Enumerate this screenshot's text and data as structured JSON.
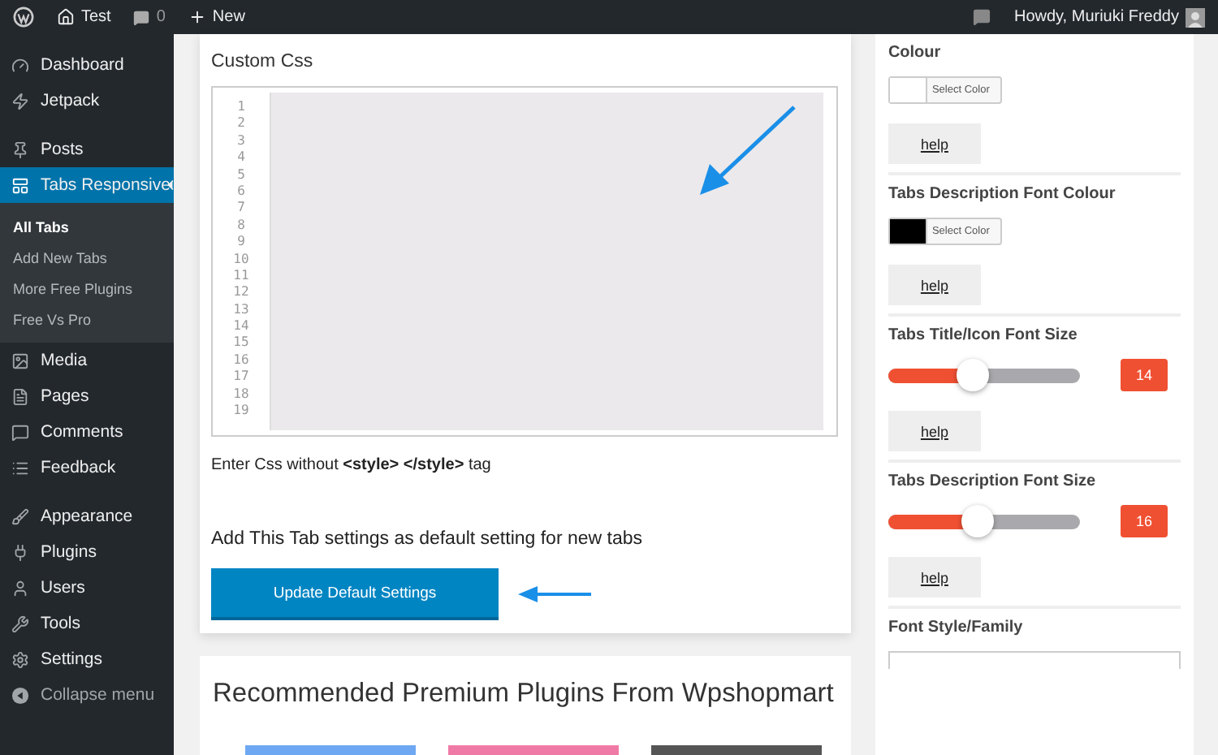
{
  "admin_bar": {
    "site": "Test",
    "comments": "0",
    "new": "New",
    "greeting": "Howdy, Muriuki Freddy"
  },
  "sidebar": {
    "items": [
      {
        "label": "Dashboard",
        "selected": false
      },
      {
        "label": "Jetpack",
        "selected": false
      },
      {
        "label": "Posts",
        "selected": false
      },
      {
        "label": "Tabs Responsive",
        "selected": true,
        "children": [
          {
            "label": "All Tabs",
            "selected": true
          },
          {
            "label": "Add New Tabs",
            "selected": false
          },
          {
            "label": "More Free Plugins",
            "selected": false
          },
          {
            "label": "Free Vs Pro",
            "selected": false
          }
        ]
      },
      {
        "label": "Media",
        "selected": false
      },
      {
        "label": "Pages",
        "selected": false
      },
      {
        "label": "Comments",
        "selected": false
      },
      {
        "label": "Feedback",
        "selected": false
      },
      {
        "label": "Appearance",
        "selected": false
      },
      {
        "label": "Plugins",
        "selected": false
      },
      {
        "label": "Users",
        "selected": false
      },
      {
        "label": "Tools",
        "selected": false
      },
      {
        "label": "Settings",
        "selected": false
      }
    ],
    "collapse": "Collapse menu"
  },
  "editor": {
    "title": "Custom Css",
    "line_numbers": [
      "1",
      "2",
      "3",
      "4",
      "5",
      "6",
      "7",
      "8",
      "9",
      "10",
      "11",
      "12",
      "13",
      "14",
      "15",
      "16",
      "17",
      "18",
      "19"
    ],
    "hint": "Enter Css without **<style>** **</style>** tag"
  },
  "default_setting": {
    "label": "Add This Tab settings as default setting for new tabs",
    "button": "Update Default Settings"
  },
  "recommended": {
    "title": "Recommended Premium Plugins From Wpshopmart"
  },
  "settings_panel": {
    "sections": [
      {
        "kind": "color",
        "title": "Colour",
        "color": "#ffffff",
        "button": "Select Color",
        "help": "help"
      },
      {
        "kind": "color",
        "title": "Tabs Description Font Colour",
        "color": "#000000",
        "button": "Select Color",
        "help": "help"
      },
      {
        "kind": "slider",
        "title": "Tabs Title/Icon Font Size",
        "level": 0.44,
        "value": "14",
        "help": "help"
      },
      {
        "kind": "slider",
        "title": "Tabs Description Font Size",
        "level": 0.47,
        "value": "16",
        "help": "help"
      },
      {
        "kind": "select",
        "title": "Font Style/Family"
      }
    ]
  }
}
